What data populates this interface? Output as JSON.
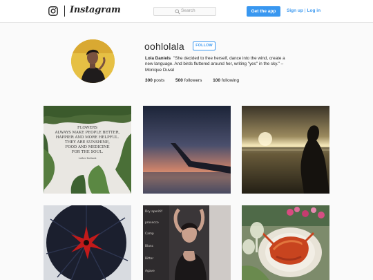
{
  "nav": {
    "wordmark": "Instagram",
    "search_placeholder": "Search",
    "get_app_label": "Get the app",
    "signup_label": "Sign up",
    "separator": "|",
    "login_label": "Log in"
  },
  "profile": {
    "username": "oohlolala",
    "follow_label": "FOLLOW",
    "full_name": "Lola Daniels",
    "bio": "\"She decided to free herself, dance into the wind, create a new language. And birds fluttered around her, writing \"yes\" in the sky.\" – Monique Duval",
    "stats": [
      {
        "count": "300",
        "label": "posts"
      },
      {
        "count": "500",
        "label": "followers"
      },
      {
        "count": "100",
        "label": "following"
      }
    ]
  },
  "posts": {
    "quote_lines": [
      "FLOWERS",
      "ALWAYS MAKE PEOPLE BETTER,",
      "HAPPIER AND MORE HELPFUL.",
      "THEY ARE SUNSHINE,",
      "FOOD AND MEDICINE",
      "FOR THE SOUL."
    ],
    "quote_author": "Luther Burbank",
    "chalk_lines": [
      "Dry aperitif",
      "prosecco",
      "Camp",
      "Blanc",
      "Bitter",
      "Agave"
    ]
  },
  "colors": {
    "accent": "#3897f0",
    "border": "#dbdbdb",
    "background": "#fafafa",
    "text": "#262626"
  },
  "icons": [
    "instagram-camera-icon",
    "search-icon"
  ]
}
